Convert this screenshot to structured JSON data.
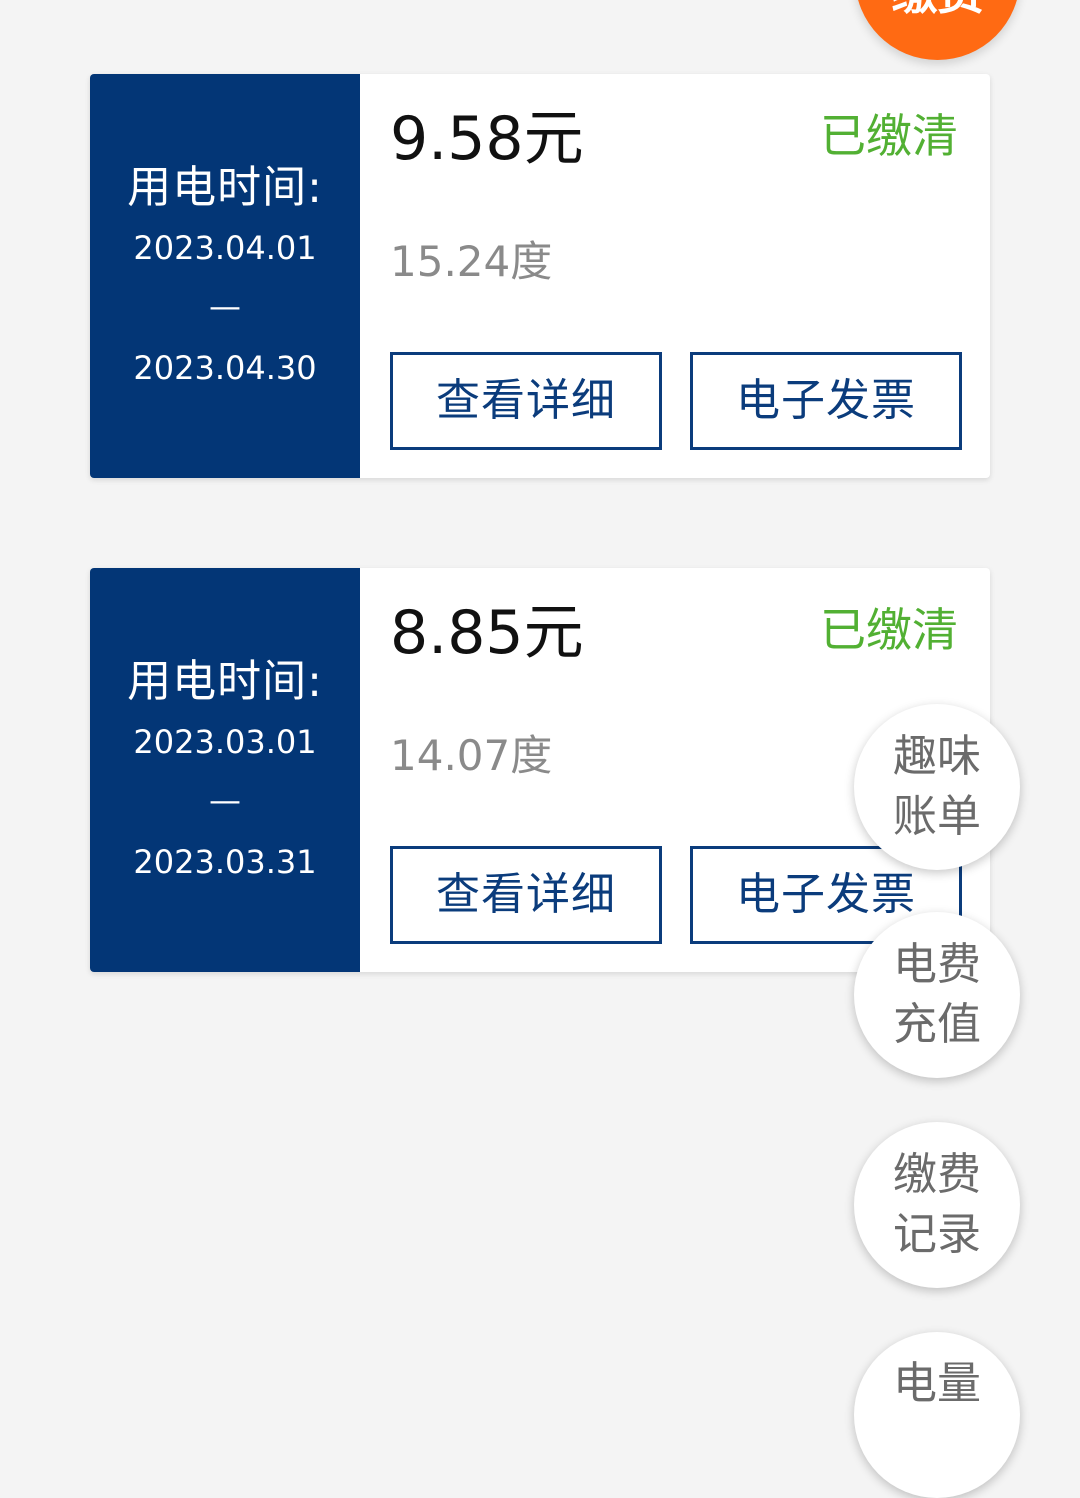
{
  "top_fab": {
    "label": "缴费"
  },
  "bills": [
    {
      "period_title": "用电时间:",
      "start": "2023.04.01",
      "separator": "—",
      "end": "2023.04.30",
      "amount": "9.58元",
      "status": "已缴清",
      "usage": "15.24度",
      "detail_label": "查看详细",
      "invoice_label": "电子发票"
    },
    {
      "period_title": "用电时间:",
      "start": "2023.03.01",
      "separator": "—",
      "end": "2023.03.31",
      "amount": "8.85元",
      "status": "已缴清",
      "usage": "14.07度",
      "detail_label": "查看详细",
      "invoice_label": "电子发票"
    }
  ],
  "side_fabs": [
    {
      "line1": "趣味",
      "line2": "账单"
    },
    {
      "line1": "电费",
      "line2": "充值"
    },
    {
      "line1": "缴费",
      "line2": "记录"
    },
    {
      "line1": "电量",
      "line2": ""
    }
  ],
  "colors": {
    "panel_blue": "#033676",
    "status_green": "#52b033",
    "fab_orange": "#ff6a13",
    "button_blue": "#0b3c7c"
  }
}
